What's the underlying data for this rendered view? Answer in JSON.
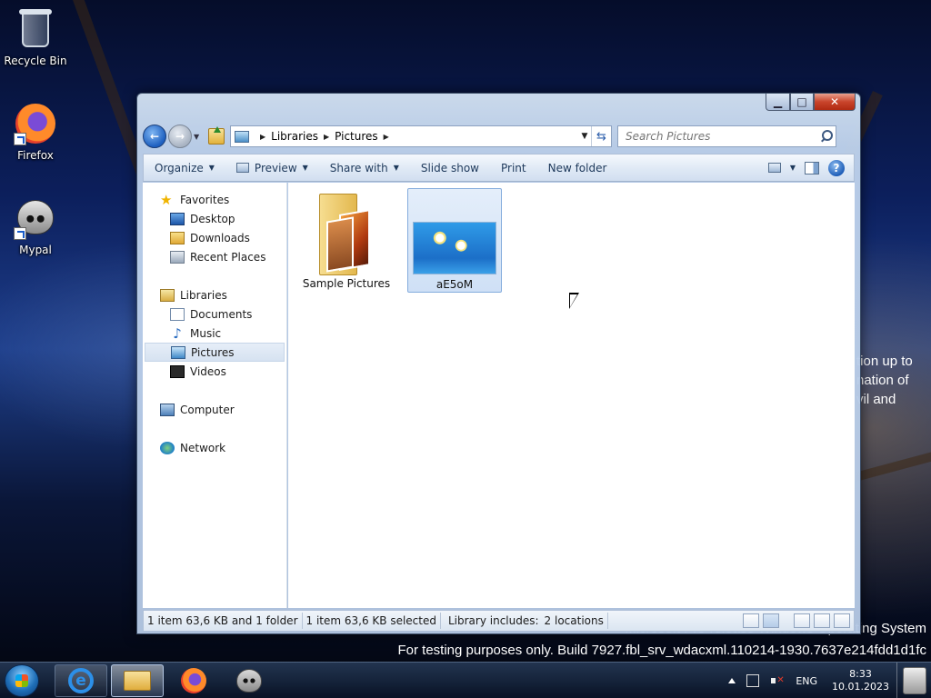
{
  "desktop": {
    "icons": [
      {
        "label": "Recycle Bin",
        "icon": "recycle-bin-icon"
      },
      {
        "label": "Firefox",
        "icon": "firefox-icon"
      },
      {
        "label": "Mypal",
        "icon": "mypal-icon"
      }
    ],
    "wallpaper_text": [
      "tion up to",
      "nation of",
      "vil and"
    ],
    "watermark": {
      "line1": "Microsoft Pre-release Windows Operating System",
      "line2": "For testing purposes only. Build 7927.fbl_srv_wdacxml.110214-1930.7637e214fdd1d1fc"
    }
  },
  "window": {
    "caption": {
      "minimize": "▁",
      "maximize": "□",
      "close": "✕"
    },
    "address": {
      "crumbs": [
        "Libraries",
        "Pictures"
      ]
    },
    "search": {
      "placeholder": "Search Pictures"
    },
    "toolbar": {
      "organize": "Organize",
      "preview": "Preview",
      "share_with": "Share with",
      "slide_show": "Slide show",
      "print": "Print",
      "new_folder": "New folder",
      "help": "?"
    },
    "nav": {
      "favorites": "Favorites",
      "desktop": "Desktop",
      "downloads": "Downloads",
      "recent_places": "Recent Places",
      "libraries": "Libraries",
      "documents": "Documents",
      "music": "Music",
      "pictures": "Pictures",
      "videos": "Videos",
      "computer": "Computer",
      "network": "Network"
    },
    "items": [
      {
        "label": "Sample Pictures",
        "type": "folder"
      },
      {
        "label": "aE5oM",
        "type": "image",
        "selected": true
      }
    ],
    "status": {
      "summary": "1 item 63,6 KB and 1 folder",
      "selection": "1 item 63,6 KB selected",
      "library_label": "Library includes:",
      "library_value": "2 locations"
    }
  },
  "taskbar": {
    "language": "ENG",
    "time": "8:33",
    "date": "10.01.2023"
  },
  "colors": {
    "window_frame": "#c8d8ec",
    "selection": "#cfe0f6",
    "close_button": "#c9442b",
    "taskbar": "#14233c"
  }
}
